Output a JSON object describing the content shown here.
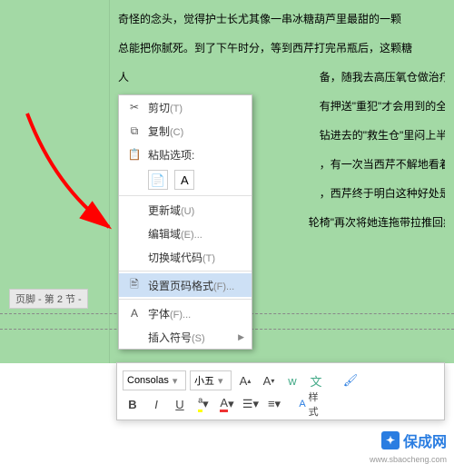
{
  "doc_lines": [
    "奇怪的念头，觉得护士长尤其像一串冰糖葫芦里最甜的一颗",
    "总能把你腻死。到了下午时分，等到西芹打完吊瓶后，这颗糖",
    "人ᅟᅟᅟᅟᅟᅟᅟᅟᅟᅟᅟᅟᅟᅟᅟᅟᅟᅟᅟ备，随我去高压氧仓做治疗。然后",
    "—ᅟᅟᅟᅟᅟᅟᅟᅟᅟᅟᅟᅟᅟᅟᅟᅟᅟᅟᅟ有押送\"重犯\"才会用到的全身响个",
    "桁ᅟᅟᅟᅟᅟᅟᅟᅟᅟᅟᅟᅟᅟᅟᅟᅟᅟᅟᅟ钻进去的\"救生仓\"里闷上半小时",
    "伯ᅟᅟᅟᅟᅟᅟᅟᅟᅟᅟᅟᅟᅟᅟᅟᅟᅟᅟᅟ，有一次当西芹不解地看着给她作",
    "伯ᅟᅟᅟᅟᅟᅟᅟᅟᅟᅟᅟᅟᅟᅟᅟᅟᅟᅟᅟ，西芹终于明白这种好处是什么了",
    "ᅟᅟᅟᅟᅟᅟᅟᅟᅟᅟᅟᅟᅟᅟᅟᅟᅟᅟᅟ轮椅\"再次将她连拖带拉推回病房"
  ],
  "footer_label": "页脚 - 第 2 节 -",
  "page_num": "2",
  "ctx": {
    "cut": "剪切",
    "cut_key": "(T)",
    "copy": "复制",
    "copy_key": "(C)",
    "paste_opts": "粘贴选项:",
    "paste_a": "A",
    "update_field": "更新域",
    "update_key": "(U)",
    "edit_field": "编辑域",
    "edit_key": "(E)...",
    "toggle_code": "切换域代码",
    "toggle_key": "(T)",
    "page_format": "设置页码格式",
    "page_format_key": "(F)...",
    "font": "字体",
    "font_key": "(F)...",
    "insert_sym": "插入符号",
    "insert_key": "(S)"
  },
  "tb": {
    "font": "Consolas",
    "size": "小五",
    "styles": "样式"
  },
  "wm": "保成网",
  "wm_sub": "www.sbaocheng.com"
}
